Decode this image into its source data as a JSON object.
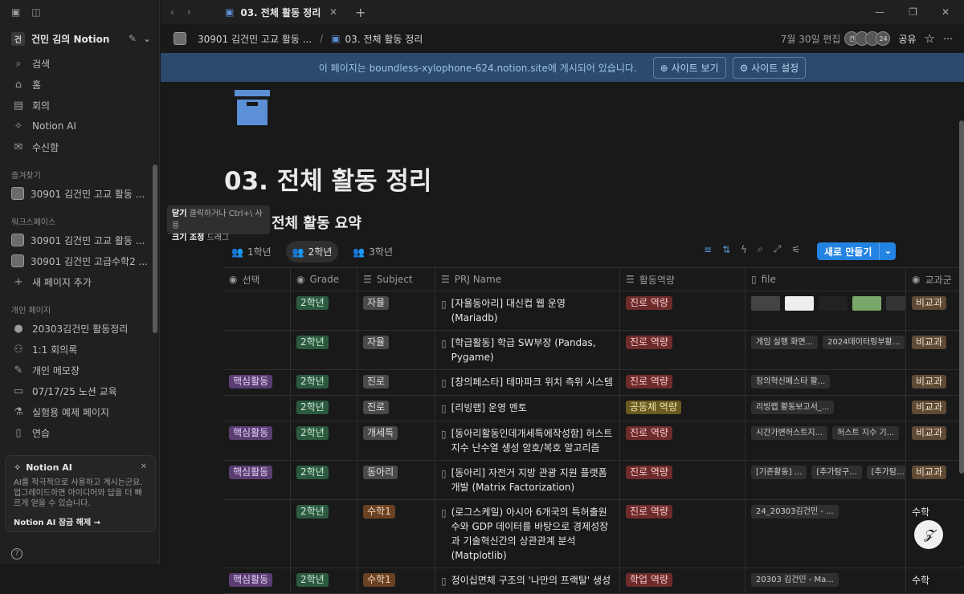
{
  "sidebar": {
    "workspace_name": "건민 김의 Notion",
    "workspace_initial": "건",
    "nav": [
      {
        "label": "검색",
        "icon": "search-icon",
        "glyph": "⌕"
      },
      {
        "label": "홈",
        "icon": "home-icon",
        "glyph": "⌂"
      },
      {
        "label": "회의",
        "icon": "meeting-icon",
        "glyph": "▤"
      },
      {
        "label": "Notion AI",
        "icon": "ai-icon",
        "glyph": "✧"
      },
      {
        "label": "수신함",
        "icon": "inbox-icon",
        "glyph": "✉"
      }
    ],
    "favorites_title": "즐겨찾기",
    "favorites": [
      "30901 김건민 고교 활동 ..."
    ],
    "workspace_title": "워크스페이스",
    "workspace_items": [
      "30901 김건민 고교 활동 ...",
      "30901 김건민 고급수학2 ..."
    ],
    "add_page": "새 페이지 추가",
    "personal_title": "개인 페이지",
    "personal": [
      {
        "label": "20303김건민 활동정리",
        "glyph": "●"
      },
      {
        "label": "1:1 회의록",
        "glyph": "⚇"
      },
      {
        "label": "개인 메모장",
        "glyph": "✎"
      },
      {
        "label": "07/17/25 노션 교육",
        "glyph": "▭"
      },
      {
        "label": "실험용 예제 페이지",
        "glyph": "⚗"
      },
      {
        "label": "연습",
        "glyph": "▯"
      }
    ],
    "ai_card": {
      "title": "Notion AI",
      "desc": "AI를 적극적으로 사용하고 계시는군요. 업그레이드하면 아이디어와 답을 더 빠르게 얻을 수 있습니다.",
      "unlock": "Notion AI 잠금 해제 →"
    }
  },
  "tooltip": {
    "line1_key": "닫기",
    "line1_text": "클릭하거나 Ctrl+\\ 사용",
    "line2_key": "크기 조정",
    "line2_text": "드래그"
  },
  "tabbar": {
    "tab_title": "03. 전체 활동 정리",
    "close": "✕",
    "plus": "+",
    "minimize": "—",
    "maximize": "❐",
    "close_window": "✕"
  },
  "topbar": {
    "crumb1": "30901 김건민 고교 활동 ...",
    "crumb2": "03. 전체 활동 정리",
    "edited": "7월 30일 편집",
    "avatars": [
      "건",
      "",
      "",
      "24"
    ],
    "share": "공유",
    "star": "☆",
    "more": "⋯"
  },
  "banner": {
    "message": "이 페이지는 boundless-xylophone-624.notion.site에 게시되어 있습니다.",
    "view_site": "사이트 보기",
    "site_settings": "사이트 설정"
  },
  "page": {
    "title": "03. 전체 활동 정리",
    "heading": "전체 활동 요약",
    "views": [
      "1학년",
      "2학년",
      "3학년"
    ],
    "active_view": "2학년",
    "new_button": "새로 만들기"
  },
  "table": {
    "columns": [
      "선택",
      "Grade",
      "Subject",
      "PRJ Name",
      "활동역량",
      "file",
      "교과군"
    ],
    "rows": [
      {
        "sel": "",
        "grade": "2학년",
        "subject": "자율",
        "subjectColor": "gray",
        "prj": "[자율동아리] 대신컵 웹 운영 (Mariadb)",
        "comp": "진로 역량",
        "compColor": "red",
        "files": [],
        "thumbs": true,
        "group": "비교과",
        "groupStyle": "tag"
      },
      {
        "sel": "",
        "grade": "2학년",
        "subject": "자율",
        "subjectColor": "gray",
        "prj": "[학급활동] 학급 SW부장 (Pandas, Pygame)",
        "comp": "진로 역량",
        "compColor": "red",
        "files": [
          "게임 실행 화면...",
          "2024데이터링부활..."
        ],
        "group": "비교과",
        "groupStyle": "tag"
      },
      {
        "sel": "핵심활동",
        "grade": "2학년",
        "subject": "진로",
        "subjectColor": "gray",
        "prj": "[창의페스타] 테마파크 위치 측위 시스템",
        "comp": "진로 역량",
        "compColor": "red",
        "files": [
          "창의혁신페스타 활..."
        ],
        "group": "비교과",
        "groupStyle": "tag"
      },
      {
        "sel": "",
        "grade": "2학년",
        "subject": "진로",
        "subjectColor": "gray",
        "prj": "[리빙랩] 운영 멘토",
        "comp": "공동체 역량",
        "compColor": "yellow",
        "files": [
          "리빙랩 활동보고서_..."
        ],
        "group": "비교과",
        "groupStyle": "tag"
      },
      {
        "sel": "핵심활동",
        "grade": "2학년",
        "subject": "개세특",
        "subjectColor": "gray",
        "prj": "[동아리활동인데개세특에작성함] 허스트 지수 난수열 생성 암호/복호 알고리즘",
        "comp": "진로 역량",
        "compColor": "red",
        "files": [
          "시간가변허스트지...",
          "허스트 지수 기..."
        ],
        "group": "비교과",
        "groupStyle": "tag"
      },
      {
        "sel": "핵심활동",
        "grade": "2학년",
        "subject": "동아리",
        "subjectColor": "gray",
        "prj": "[동아리] 자전거 지방 관광 지원 플랫폼 개발 (Matrix Factorization)",
        "comp": "진로 역량",
        "compColor": "red",
        "files": [
          "[기존활동] ...",
          "[추가탐구...",
          "[추가탐..."
        ],
        "group": "비교과",
        "groupStyle": "tag"
      },
      {
        "sel": "",
        "grade": "2학년",
        "subject": "수학1",
        "subjectColor": "orange",
        "prj": "(로그스케일) 아시아 6개국의 특허출원수와 GDP 데이터를 바탕으로 경제성장과 기술혁신간의 상관관계 분석 (Matplotlib)",
        "comp": "진로 역량",
        "compColor": "red",
        "files": [
          "24_20303김건민 - ..."
        ],
        "group": "수학",
        "groupStyle": "plain"
      },
      {
        "sel": "핵심활동",
        "grade": "2학년",
        "subject": "수학1",
        "subjectColor": "orange",
        "prj": "정이십면체 구조의 '나만의 프랙탈' 생성",
        "comp": "학업 역량",
        "compColor": "red",
        "files": [
          "20303 김건민 - Ma..."
        ],
        "group": "수학",
        "groupStyle": "plain"
      }
    ]
  },
  "fab_glyph": "𝓩"
}
